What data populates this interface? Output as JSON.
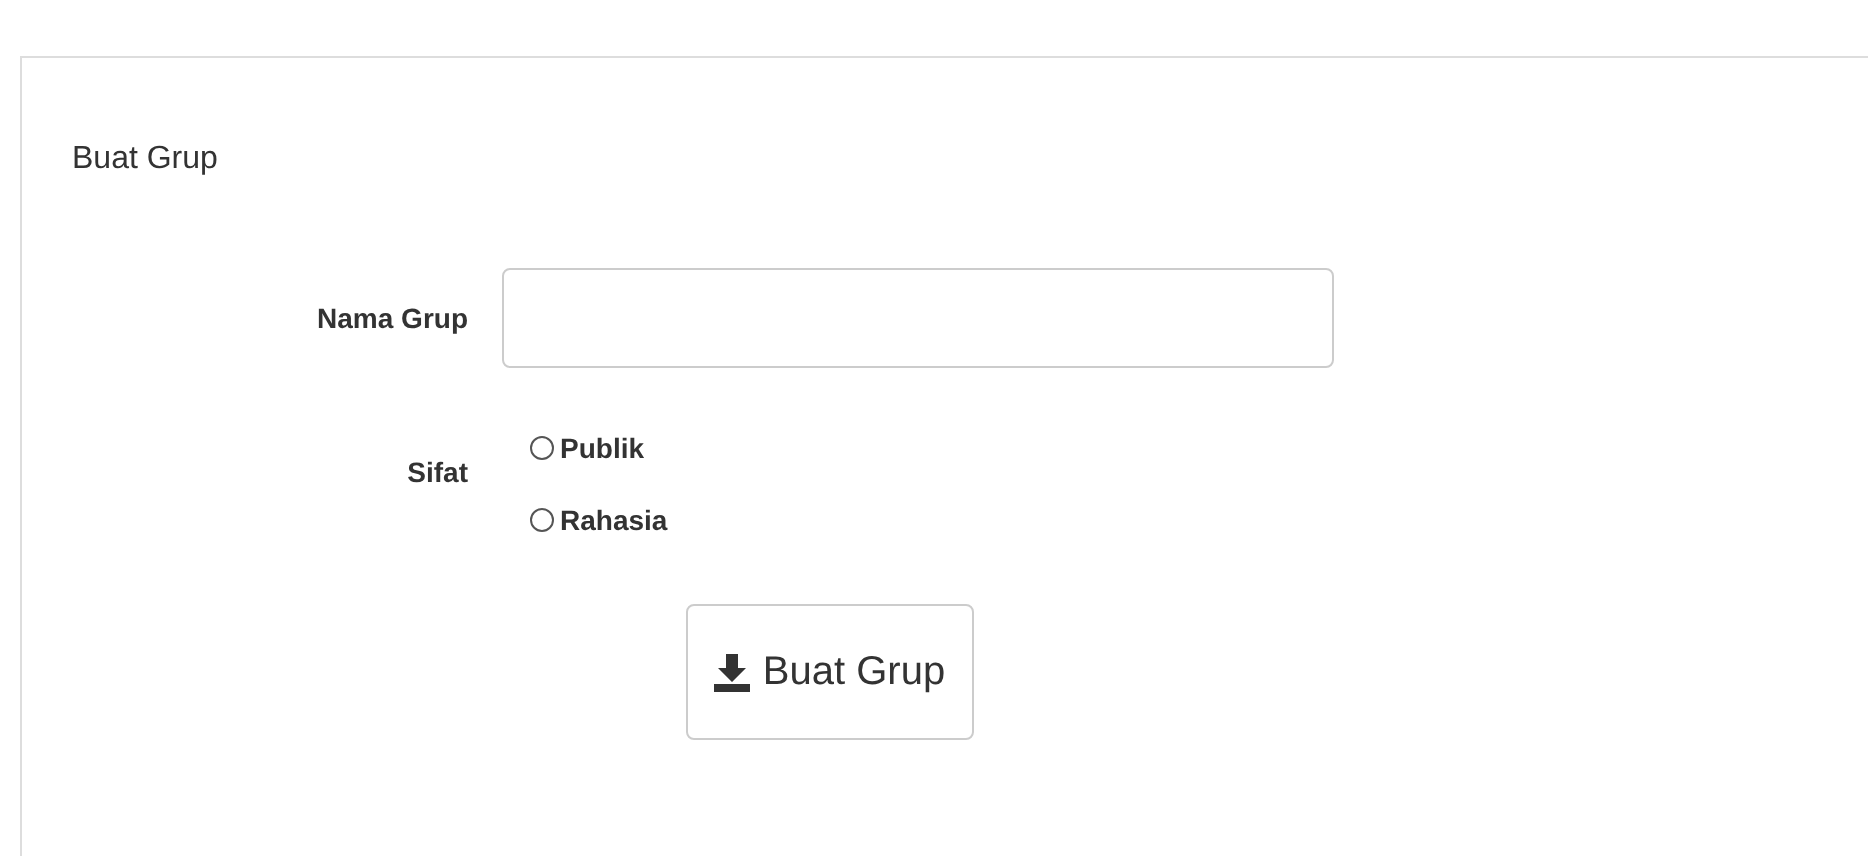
{
  "panel": {
    "title": "Buat Grup"
  },
  "form": {
    "name_label": "Nama Grup",
    "type_label": "Sifat",
    "options": [
      {
        "label": "Publik",
        "selected": false
      },
      {
        "label": "Rahasia",
        "selected": false
      }
    ],
    "submit": "Buat Grup"
  }
}
